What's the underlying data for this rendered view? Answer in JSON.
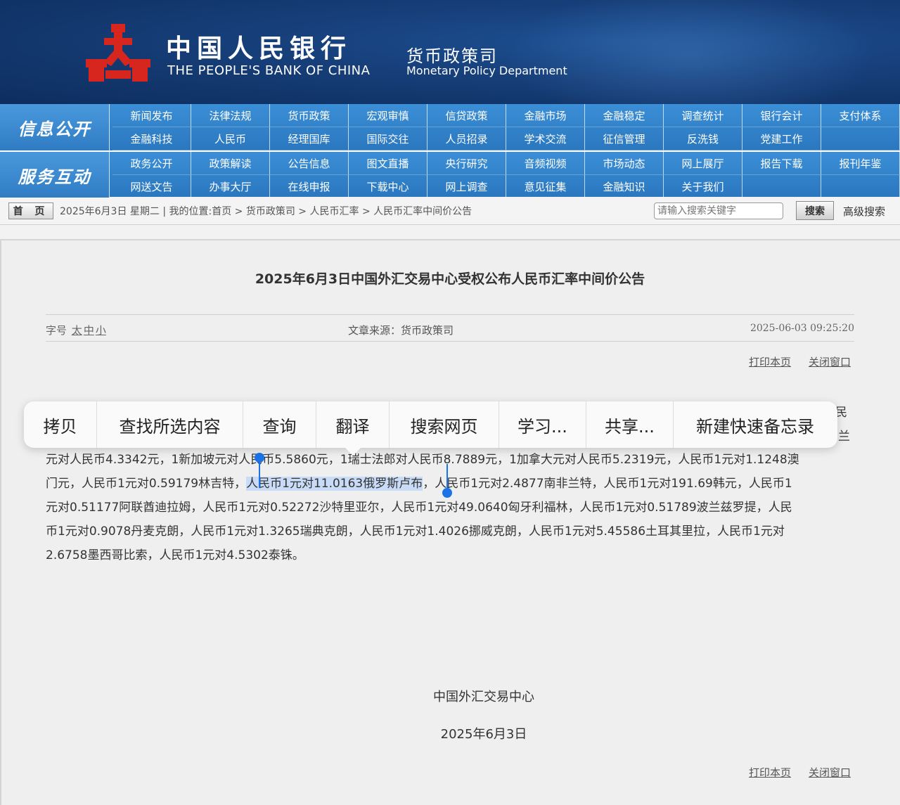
{
  "header": {
    "cn_name": "中国人民银行",
    "en_name": "THE PEOPLE'S BANK OF CHINA",
    "dept_cn": "货币政策司",
    "dept_en": "Monetary Policy Department"
  },
  "nav": {
    "row1": {
      "category": "信息公开",
      "items": [
        "新闻发布",
        "法律法规",
        "货币政策",
        "宏观审慎",
        "信贷政策",
        "金融市场",
        "金融稳定",
        "调查统计",
        "银行会计",
        "支付体系",
        "金融科技",
        "人民币",
        "经理国库",
        "国际交往",
        "人员招录",
        "学术交流",
        "征信管理",
        "反洗钱",
        "党建工作",
        ""
      ]
    },
    "row2": {
      "category": "服务互动",
      "items": [
        "政务公开",
        "政策解读",
        "公告信息",
        "图文直播",
        "央行研究",
        "音频视频",
        "市场动态",
        "网上展厅",
        "报告下载",
        "报刊年鉴",
        "网送文告",
        "办事大厅",
        "在线申报",
        "下载中心",
        "网上调查",
        "意见征集",
        "金融知识",
        "关于我们",
        "",
        ""
      ]
    }
  },
  "breadcrumb": {
    "home": "首 页",
    "text": "2025年6月3日 星期二 | 我的位置:首页 > 货币政策司 > 人民币汇率 > 人民币汇率中间价公告",
    "search_placeholder": "请输入搜索关键字",
    "search_button": "搜索",
    "advanced": "高级搜索"
  },
  "article": {
    "title": "2025年6月3日中国外汇交易中心受权公布人民币汇率中间价公告",
    "font_label": "字号",
    "font_large": "太",
    "font_medium": "中",
    "font_small": "小",
    "source": "文章来源：货币政策司",
    "time": "2025-06-03 09:25:20",
    "print": "打印本页",
    "close": "关闭窗口",
    "peek_right_1": "民",
    "peek_right_2": "兰",
    "line1": "元对人民币4.3342元，1新加坡元对人民币5.5860元，1瑞士法郎对人民币8.7889元，1加拿大元对人民币5.2319元，人民币1元对1.1248澳",
    "line2_pre": "门元，人民币1元对0.59179林吉特，",
    "line2_sel": "人民币1元对11.0163俄罗斯卢布",
    "line2_post": "，人民币1元对2.4877南非兰特，人民币1元对191.69韩元，人民币1",
    "line3": "元对0.51177阿联酋迪拉姆，人民币1元对0.52272沙特里亚尔，人民币1元对49.0640匈牙利福林，人民币1元对0.51789波兰兹罗提，人民",
    "line4": "币1元对0.9078丹麦克朗，人民币1元对1.3265瑞典克朗，人民币1元对1.4026挪威克朗，人民币1元对5.45586土耳其里拉，人民币1元对",
    "line5": "2.6758墨西哥比索，人民币1元对4.5302泰铢。",
    "org": "中国外汇交易中心",
    "date": "2025年6月3日"
  },
  "context_menu": {
    "items": [
      "拷贝",
      "查找所选内容",
      "查询",
      "翻译",
      "搜索网页",
      "学习...",
      "共享...",
      "新建快速备忘录"
    ]
  },
  "colors": {
    "header_bg": "#163e78",
    "nav_bg": "#2e7ec7",
    "selection": "#c9dcf7",
    "caret": "#1a73e8",
    "logo_red": "#d7261e"
  }
}
